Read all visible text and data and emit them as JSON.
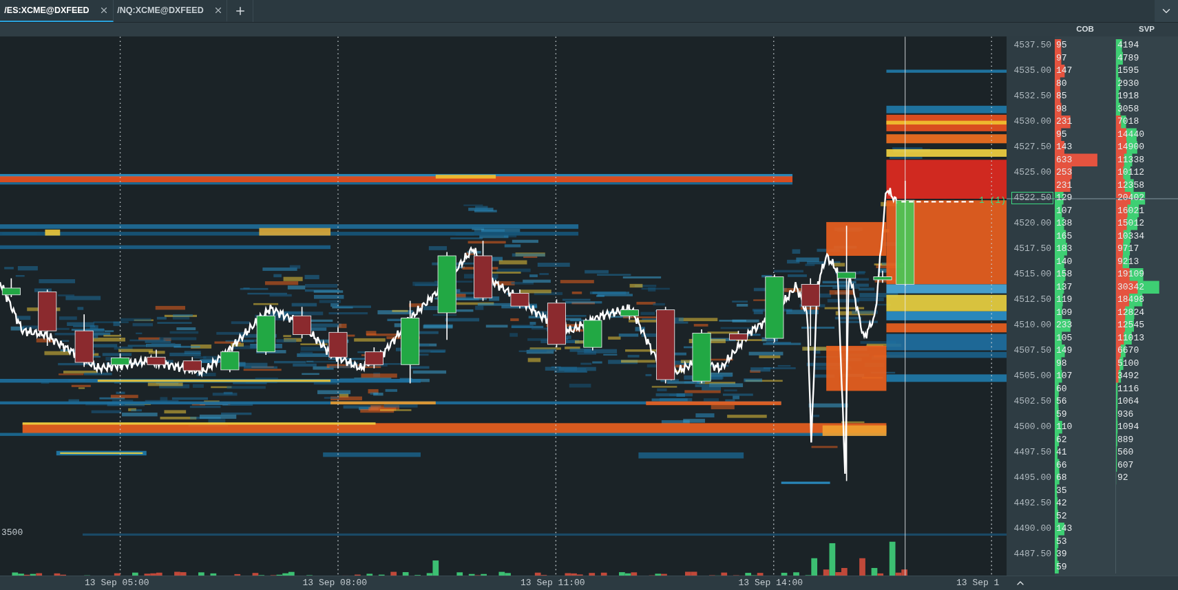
{
  "tabs": [
    {
      "label": "/ES:XCME@DXFEED",
      "selected": true
    },
    {
      "label": "/NQ:XCME@DXFEED",
      "selected": false
    }
  ],
  "chart": {
    "volume_scale_label": "3500",
    "order_marker": "1 (1)",
    "time_labels": [
      "13 Sep 05:00",
      "13 Sep 08:00",
      "13 Sep 11:00",
      "13 Sep 14:00",
      "13 Sep 1"
    ]
  },
  "ladder": {
    "columns": [
      "COB",
      "SVP"
    ],
    "rows": [
      {
        "price": "4537.50",
        "cob": {
          "value": "95"
        },
        "current": false,
        "svp": {
          "value": "4194"
        }
      },
      {
        "cob": {
          "value": "97"
        },
        "current": false,
        "svp": {
          "value": "4789"
        }
      },
      {
        "price": "4535.00",
        "cob": {
          "value": "147"
        },
        "current": false,
        "svp": {
          "value": "1595"
        }
      },
      {
        "cob": {
          "value": "80"
        },
        "current": false,
        "svp": {
          "value": "2930"
        }
      },
      {
        "price": "4532.50",
        "cob": {
          "value": "85"
        },
        "current": false,
        "svp": {
          "value": "1918"
        }
      },
      {
        "cob": {
          "value": "98"
        },
        "current": false,
        "svp": {
          "value": "3058"
        }
      },
      {
        "price": "4530.00",
        "cob": {
          "value": "231"
        },
        "current": false,
        "svp": {
          "value": "7018"
        }
      },
      {
        "cob": {
          "value": "95"
        },
        "current": false,
        "svp": {
          "value": "14440"
        }
      },
      {
        "price": "4527.50",
        "cob": {
          "value": "143"
        },
        "current": false,
        "svp": {
          "value": "14900"
        }
      },
      {
        "cob": {
          "value": "633"
        },
        "current": false,
        "svp": {
          "value": "11338"
        }
      },
      {
        "price": "4525.00",
        "cob": {
          "value": "253"
        },
        "current": false,
        "svp": {
          "value": "10112"
        }
      },
      {
        "cob": {
          "value": "231"
        },
        "current": false,
        "svp": {
          "value": "12358"
        }
      },
      {
        "price": "4522.50",
        "cob": {
          "value": "129"
        },
        "current": true,
        "svp": {
          "value": "20402"
        }
      },
      {
        "cob": {
          "value": "107"
        },
        "current": false,
        "svp": {
          "value": "16021"
        }
      },
      {
        "price": "4520.00",
        "cob": {
          "value": "138"
        },
        "current": false,
        "svp": {
          "value": "15012"
        }
      },
      {
        "cob": {
          "value": "165"
        },
        "current": false,
        "svp": {
          "value": "10334"
        }
      },
      {
        "price": "4517.50",
        "cob": {
          "value": "183"
        },
        "current": false,
        "svp": {
          "value": "9717"
        }
      },
      {
        "cob": {
          "value": "140"
        },
        "current": false,
        "svp": {
          "value": "9213"
        }
      },
      {
        "price": "4515.00",
        "cob": {
          "value": "158"
        },
        "current": false,
        "svp": {
          "value": "19109"
        }
      },
      {
        "cob": {
          "value": "137"
        },
        "current": false,
        "svp": {
          "value": "30342"
        }
      },
      {
        "price": "4512.50",
        "cob": {
          "value": "119"
        },
        "current": false,
        "svp": {
          "value": "18498"
        }
      },
      {
        "cob": {
          "value": "109"
        },
        "current": false,
        "svp": {
          "value": "12824"
        }
      },
      {
        "price": "4510.00",
        "cob": {
          "value": "233"
        },
        "current": false,
        "svp": {
          "value": "12545"
        }
      },
      {
        "cob": {
          "value": "105"
        },
        "current": false,
        "svp": {
          "value": "11013"
        }
      },
      {
        "price": "4507.50",
        "cob": {
          "value": "149"
        },
        "current": false,
        "svp": {
          "value": "6670"
        }
      },
      {
        "cob": {
          "value": "98"
        },
        "current": false,
        "svp": {
          "value": "5100"
        }
      },
      {
        "price": "4505.00",
        "cob": {
          "value": "107"
        },
        "current": false,
        "svp": {
          "value": "3492"
        }
      },
      {
        "cob": {
          "value": "60"
        },
        "current": false,
        "svp": {
          "value": "1116"
        }
      },
      {
        "price": "4502.50",
        "cob": {
          "value": "56"
        },
        "current": false,
        "svp": {
          "value": "1064"
        }
      },
      {
        "cob": {
          "value": "59"
        },
        "current": false,
        "svp": {
          "value": "936"
        }
      },
      {
        "price": "4500.00",
        "cob": {
          "value": "110"
        },
        "current": false,
        "svp": {
          "value": "1094"
        }
      },
      {
        "cob": {
          "value": "62"
        },
        "current": false,
        "svp": {
          "value": "889"
        }
      },
      {
        "price": "4497.50",
        "cob": {
          "value": "41"
        },
        "current": false,
        "svp": {
          "value": "560"
        }
      },
      {
        "cob": {
          "value": "66"
        },
        "current": false,
        "svp": {
          "value": "607"
        }
      },
      {
        "price": "4495.00",
        "cob": {
          "value": "68"
        },
        "current": false,
        "svp": {
          "value": "92"
        }
      },
      {
        "cob": {
          "value": "35"
        },
        "current": false
      },
      {
        "price": "4492.50",
        "cob": {
          "value": "42"
        },
        "current": false
      },
      {
        "cob": {
          "value": "52"
        },
        "current": false
      },
      {
        "price": "4490.00",
        "cob": {
          "value": "143"
        },
        "current": false
      },
      {
        "cob": {
          "value": "53"
        },
        "current": false
      },
      {
        "price": "4487.50",
        "cob": {
          "value": "39"
        },
        "current": false
      },
      {
        "cob": {
          "value": "59"
        },
        "current": false
      }
    ]
  }
}
